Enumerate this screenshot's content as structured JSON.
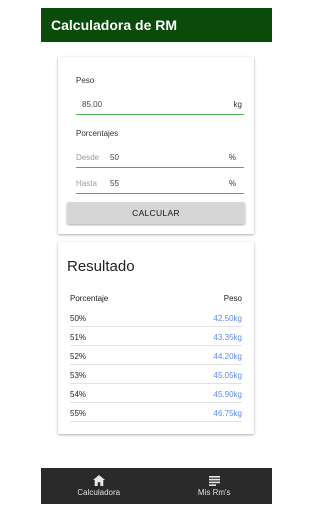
{
  "app": {
    "title": "Calculadora de RM"
  },
  "form": {
    "peso_label": "Peso",
    "peso_value": "85.00",
    "peso_unit": "kg",
    "porcentajes_label": "Porcentajes",
    "desde_placeholder": "Desde",
    "desde_value": "50",
    "hasta_placeholder": "Hasta",
    "hasta_value": "55",
    "pct_unit": "%",
    "button_label": "CALCULAR"
  },
  "result": {
    "title": "Resultado",
    "columns": {
      "pct": "Porcentaje",
      "weight": "Peso"
    },
    "rows": [
      {
        "pct": "50%",
        "weight": "42.50kg"
      },
      {
        "pct": "51%",
        "weight": "43.35kg"
      },
      {
        "pct": "52%",
        "weight": "44.20kg"
      },
      {
        "pct": "53%",
        "weight": "45.05kg"
      },
      {
        "pct": "54%",
        "weight": "45.90kg"
      },
      {
        "pct": "55%",
        "weight": "46.75kg"
      }
    ]
  },
  "nav": {
    "items": [
      {
        "label": "Calculadora",
        "icon": "home-icon"
      },
      {
        "label": "Mis Rm's",
        "icon": "list-icon"
      }
    ]
  },
  "colors": {
    "appbar": "#0a4a0a",
    "accent": "#4caf50",
    "link": "#5b8def",
    "nav_bg": "#2a2a2a"
  }
}
